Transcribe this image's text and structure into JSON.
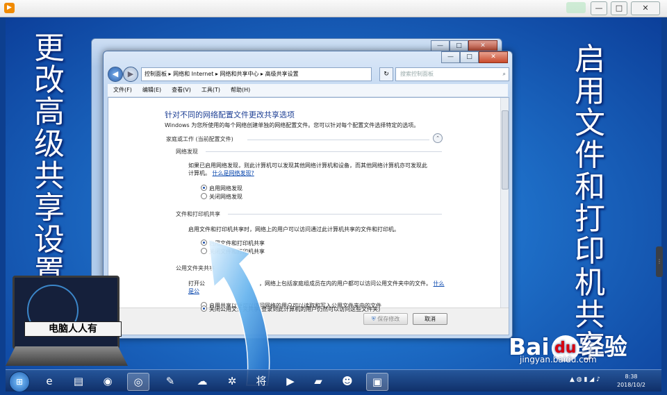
{
  "player": {
    "controls": [
      "—",
      "□",
      "✕"
    ]
  },
  "side_text_left": "更改高级共享设置",
  "side_text_right": "启用文件和打印机共享",
  "window": {
    "caption_min": "—",
    "caption_max": "□",
    "caption_close": "✕",
    "address": "控制面板 ▸ 网络和 Internet ▸ 网络和共享中心 ▸ 高级共享设置",
    "search_placeholder": "搜索控制面板",
    "menu": [
      "文件(F)",
      "编辑(E)",
      "查看(V)",
      "工具(T)",
      "帮助(H)"
    ],
    "content": {
      "title": "针对不同的网络配置文件更改共享选项",
      "description": "Windows 为您所使用的每个网络创建单独的网络配置文件。您可以针对每个配置文件选择特定的选项。",
      "profile_header": "家庭或工作 (当前配置文件)",
      "network_discovery": {
        "heading": "网络发现",
        "desc_line1": "如果已启用网络发现，则此计算机可以发现其他网络计算机和设备，而其他网络计算机亦可发现此",
        "desc_line2": "计算机。",
        "link": "什么是网络发现?",
        "option_on": "启用网络发现",
        "option_off": "关闭网络发现"
      },
      "file_printer_sharing": {
        "heading": "文件和打印机共享",
        "desc": "启用文件和打印机共享时，网络上的用户可以访问通过此计算机共享的文件和打印机。",
        "option_on": "启用文件和打印机共享",
        "option_off": "关闭文件和打印机共享"
      },
      "public_folder": {
        "heading": "公用文件夹共享",
        "desc_start": "打开公",
        "desc_mid": "，网络上包括家庭组成员在内的用户都可以访问公用文件夹中的文件。",
        "link1": "什么",
        "link2": "是公",
        "option_on": "启用共享以便可以访问网络的用户可以读取和写入公用文件夹中的文件",
        "option_off": "关闭公用文件夹共享(登录到此计算机的用户仍然可以访问这些文件夹)"
      },
      "buttons": {
        "save": "保存修改",
        "cancel": "取消"
      }
    }
  },
  "logo_label": "电脑人人有",
  "watermark": {
    "brand_left": "Bai",
    "brand_paw": "du",
    "brand_right": "经验",
    "url": "jingyan.baidu.com"
  },
  "taskbar": {
    "start": "⊞",
    "icons": [
      {
        "name": "ie-icon",
        "glyph": "e"
      },
      {
        "name": "folder-icon",
        "glyph": "▤"
      },
      {
        "name": "chrome-icon",
        "glyph": "◉"
      },
      {
        "name": "network-icon",
        "glyph": "◎"
      },
      {
        "name": "paint-icon",
        "glyph": "✎"
      },
      {
        "name": "cloud-icon",
        "glyph": "☁"
      },
      {
        "name": "pinwheel-icon",
        "glyph": "✲"
      },
      {
        "name": "jiang-icon",
        "glyph": "将"
      },
      {
        "name": "player-icon",
        "glyph": "▶"
      },
      {
        "name": "book-icon",
        "glyph": "▰"
      },
      {
        "name": "face-icon",
        "glyph": "☻"
      },
      {
        "name": "control-panel-icon",
        "glyph": "▣"
      }
    ],
    "time": "8:38",
    "date": "2018/10/2"
  }
}
